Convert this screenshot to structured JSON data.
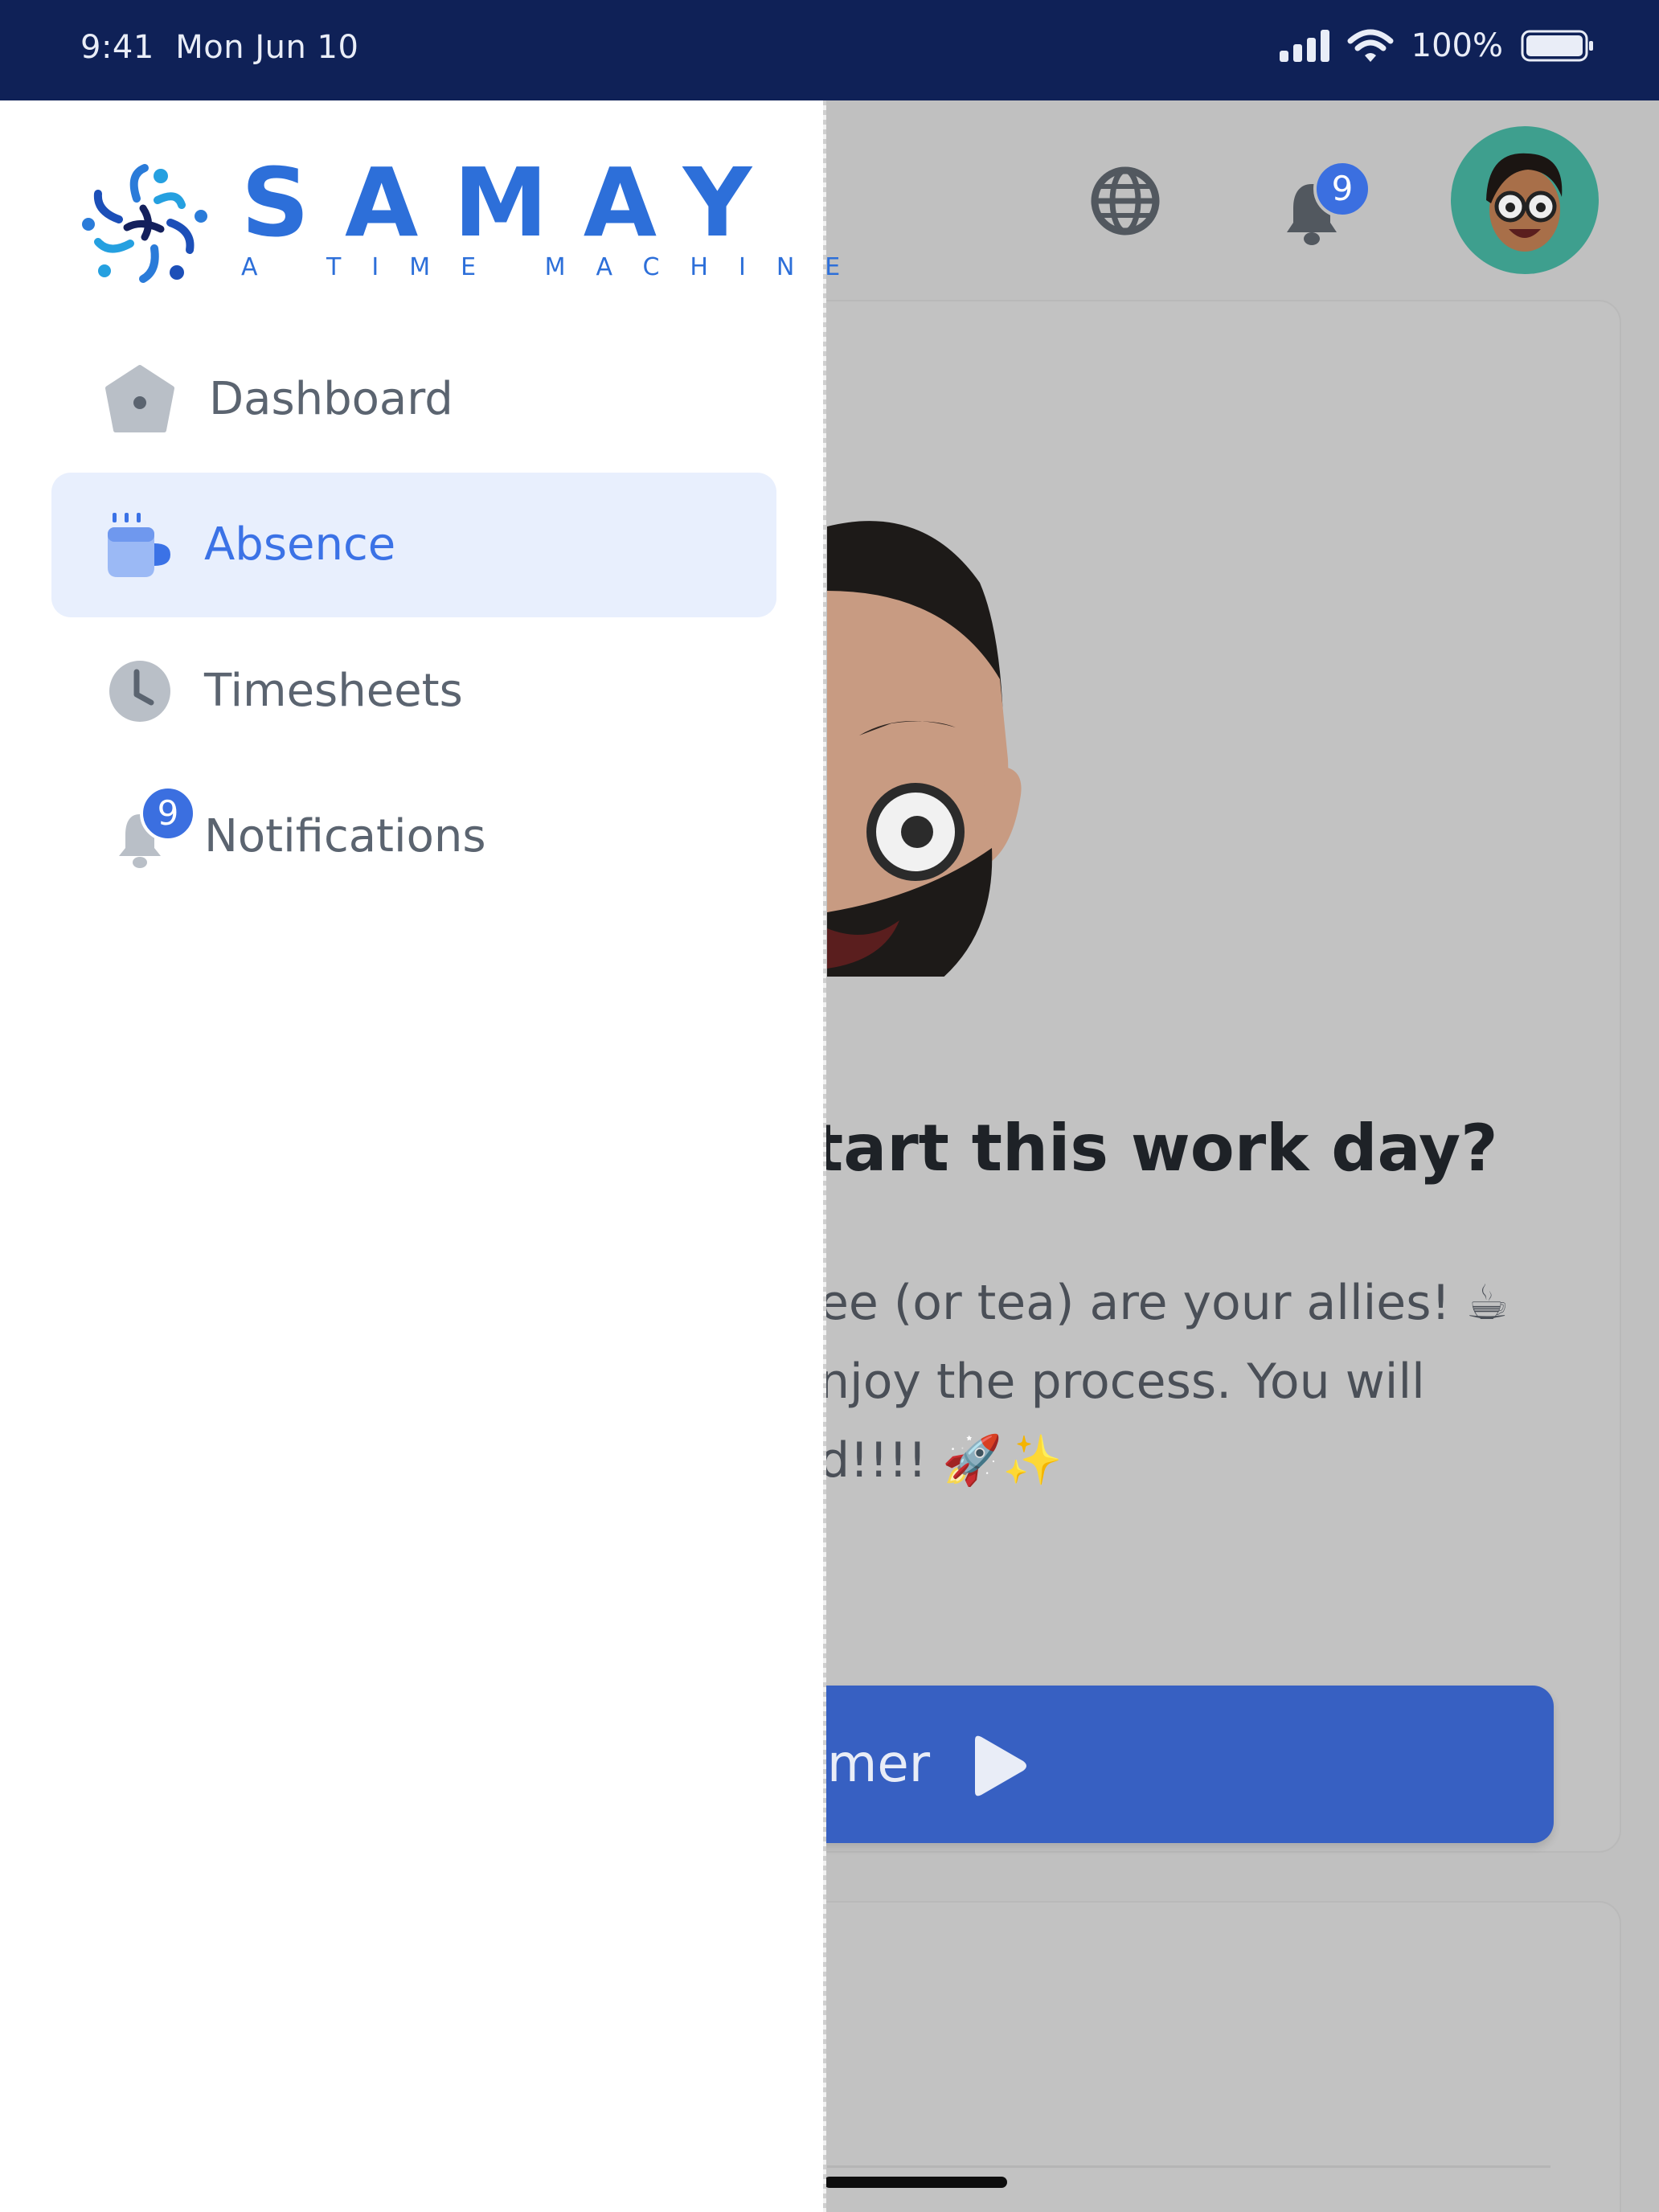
{
  "status_bar": {
    "time": "9:41",
    "date": "Mon Jun 10",
    "battery": "100%"
  },
  "header": {
    "notification_count": "9",
    "icons": [
      "globe-icon",
      "bell-icon",
      "avatar"
    ]
  },
  "brand": {
    "name": "SAMAY",
    "tagline": "A TIME MACHINE",
    "color": "#2d6fd9"
  },
  "nav": {
    "items": [
      {
        "label": "Dashboard",
        "icon": "home-icon",
        "active": false
      },
      {
        "label": "Absence",
        "icon": "coffee-cup-icon",
        "active": true
      },
      {
        "label": "Timesheets",
        "icon": "clock-icon",
        "active": false
      },
      {
        "label": "Notifications",
        "icon": "bell-icon",
        "active": false,
        "badge": "9"
      }
    ]
  },
  "main": {
    "headline": "tart this work day?",
    "body_lines": [
      "ee (or tea) are your allies! ☕",
      "njoy the process. You will",
      "d!!!! 🚀✨"
    ],
    "cta_label": "mer"
  },
  "colors": {
    "status_bar_bg": "#0f2157",
    "accent": "#3b72e6",
    "cta": "#3760c2",
    "active_nav_bg": "#e8effd",
    "badge": "#3b6fe0"
  }
}
